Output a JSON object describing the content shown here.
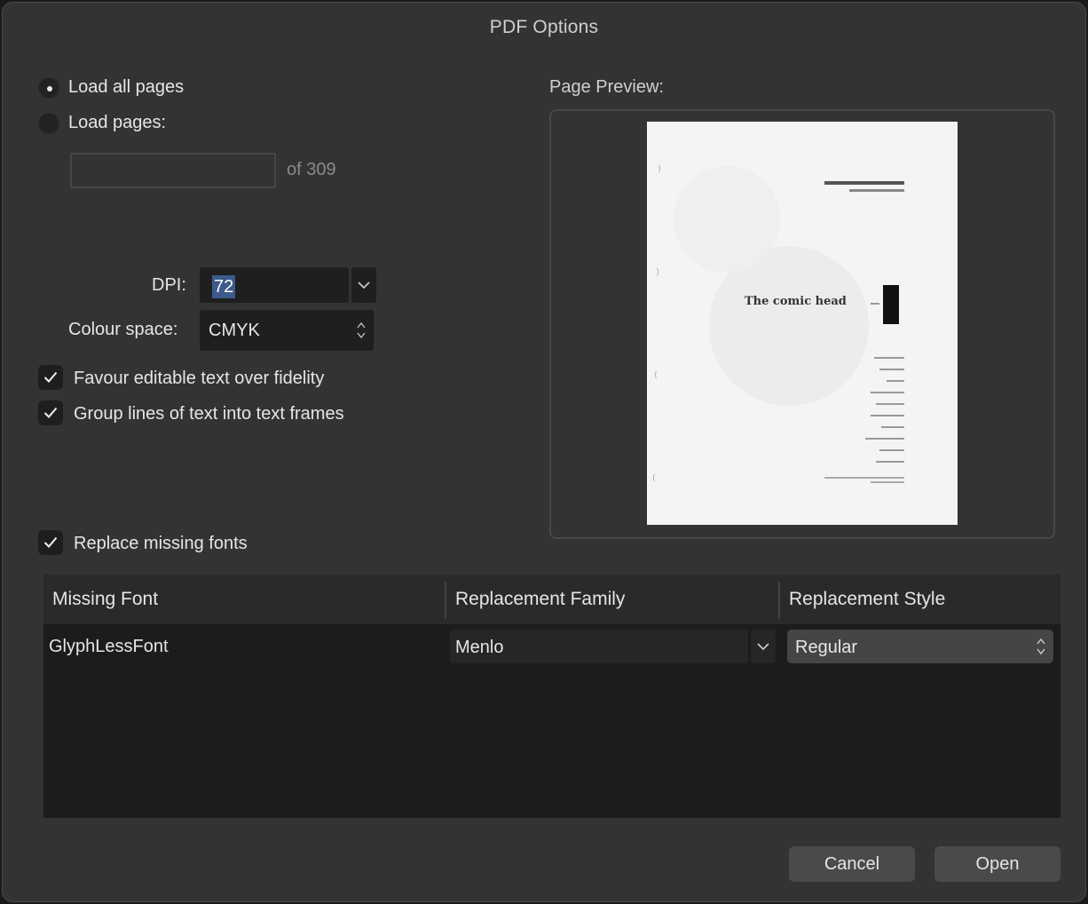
{
  "dialog": {
    "title": "PDF Options"
  },
  "load": {
    "all_label": "Load all pages",
    "pages_label": "Load pages:",
    "selected": "all",
    "pages_value": "",
    "of_label": "of 309"
  },
  "dpi": {
    "label": "DPI:",
    "value": "72"
  },
  "colour_space": {
    "label": "Colour space:",
    "value": "CMYK"
  },
  "options": {
    "favour_editable": {
      "label": "Favour editable text over fidelity",
      "checked": true
    },
    "group_lines": {
      "label": "Group lines of text into text frames",
      "checked": true
    },
    "replace_fonts": {
      "label": "Replace missing fonts",
      "checked": true
    }
  },
  "preview": {
    "label": "Page Preview:",
    "page_title": "The comic head"
  },
  "fonts_table": {
    "columns": [
      "Missing Font",
      "Replacement Family",
      "Replacement Style"
    ],
    "rows": [
      {
        "missing": "GlyphLessFont",
        "family": "Menlo",
        "style": "Regular"
      }
    ]
  },
  "buttons": {
    "cancel": "Cancel",
    "open": "Open"
  },
  "icons": {
    "dropdown": "chevron-down-icon",
    "stepper": "up-down-chevron-icon",
    "check": "checkmark-icon"
  }
}
